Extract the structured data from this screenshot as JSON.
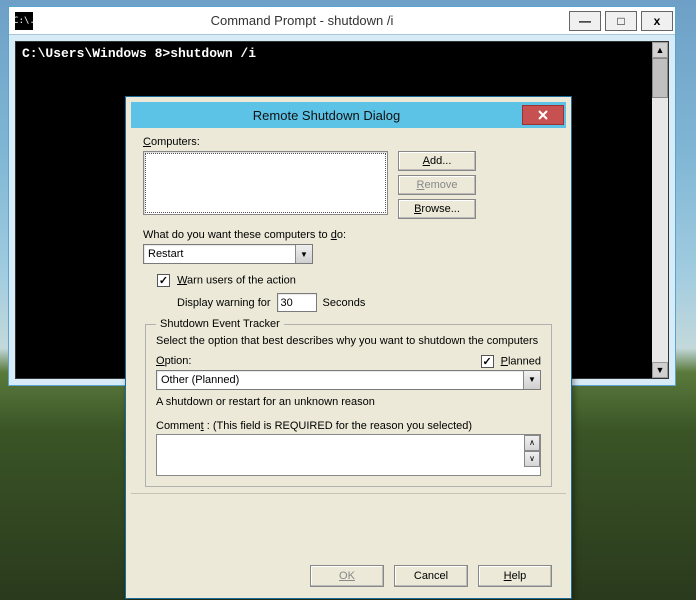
{
  "cmd": {
    "title": "Command Prompt - shutdown  /i",
    "icon_text": "C:\\.",
    "line1": "C:\\Users\\Windows 8>shutdown /i",
    "btn_min": "—",
    "btn_max": "□",
    "btn_close": "x"
  },
  "dlg": {
    "title": "Remote Shutdown Dialog",
    "computers_label": "Computers:",
    "add": "Add...",
    "remove": "Remove",
    "browse": "Browse...",
    "action_label": "What do you want these computers to do:",
    "action_value": "Restart",
    "warn_label": "Warn users of the action",
    "warn_checked": "✓",
    "display_warning": "Display warning for",
    "seconds_value": "30",
    "seconds_label": "Seconds",
    "tracker_legend": "Shutdown Event Tracker",
    "tracker_desc": "Select the option that best describes why you want to shutdown the computers",
    "option_label": "Option:",
    "planned_checked": "✓",
    "planned_label": "Planned",
    "option_value": "Other (Planned)",
    "reason_desc": "A shutdown or restart for an unknown reason",
    "comment_label": "Comment : (This field is REQUIRED for the reason you selected)",
    "ok": "OK",
    "cancel": "Cancel",
    "help": "Help"
  }
}
